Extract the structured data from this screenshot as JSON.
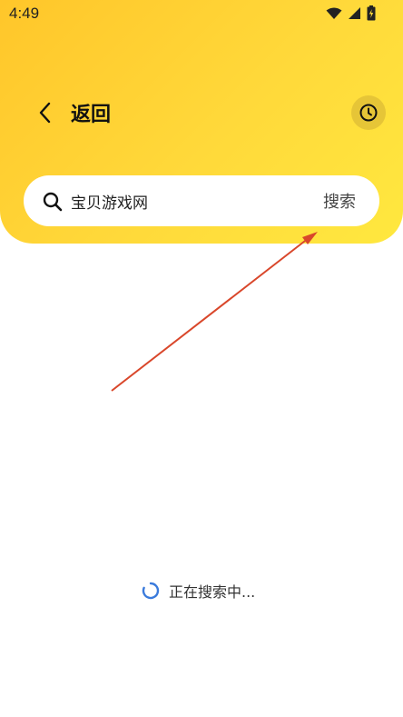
{
  "status_bar": {
    "time": "4:49",
    "icons": [
      "wifi-icon",
      "signal-icon",
      "battery-charging-icon"
    ]
  },
  "header": {
    "title": "返回",
    "back_icon": "chevron-left-icon",
    "history_icon": "clock-icon"
  },
  "search": {
    "value": "宝贝游戏网",
    "submit_label": "搜索",
    "search_icon": "search-icon"
  },
  "loading": {
    "text": "正在搜索中..."
  },
  "colors": {
    "header_gradient_start": "#ffc62a",
    "header_gradient_end": "#ffe83f",
    "history_button_bg": "#e6c537",
    "annotation_arrow": "#d9472b",
    "spinner": "#3b7bdc"
  }
}
